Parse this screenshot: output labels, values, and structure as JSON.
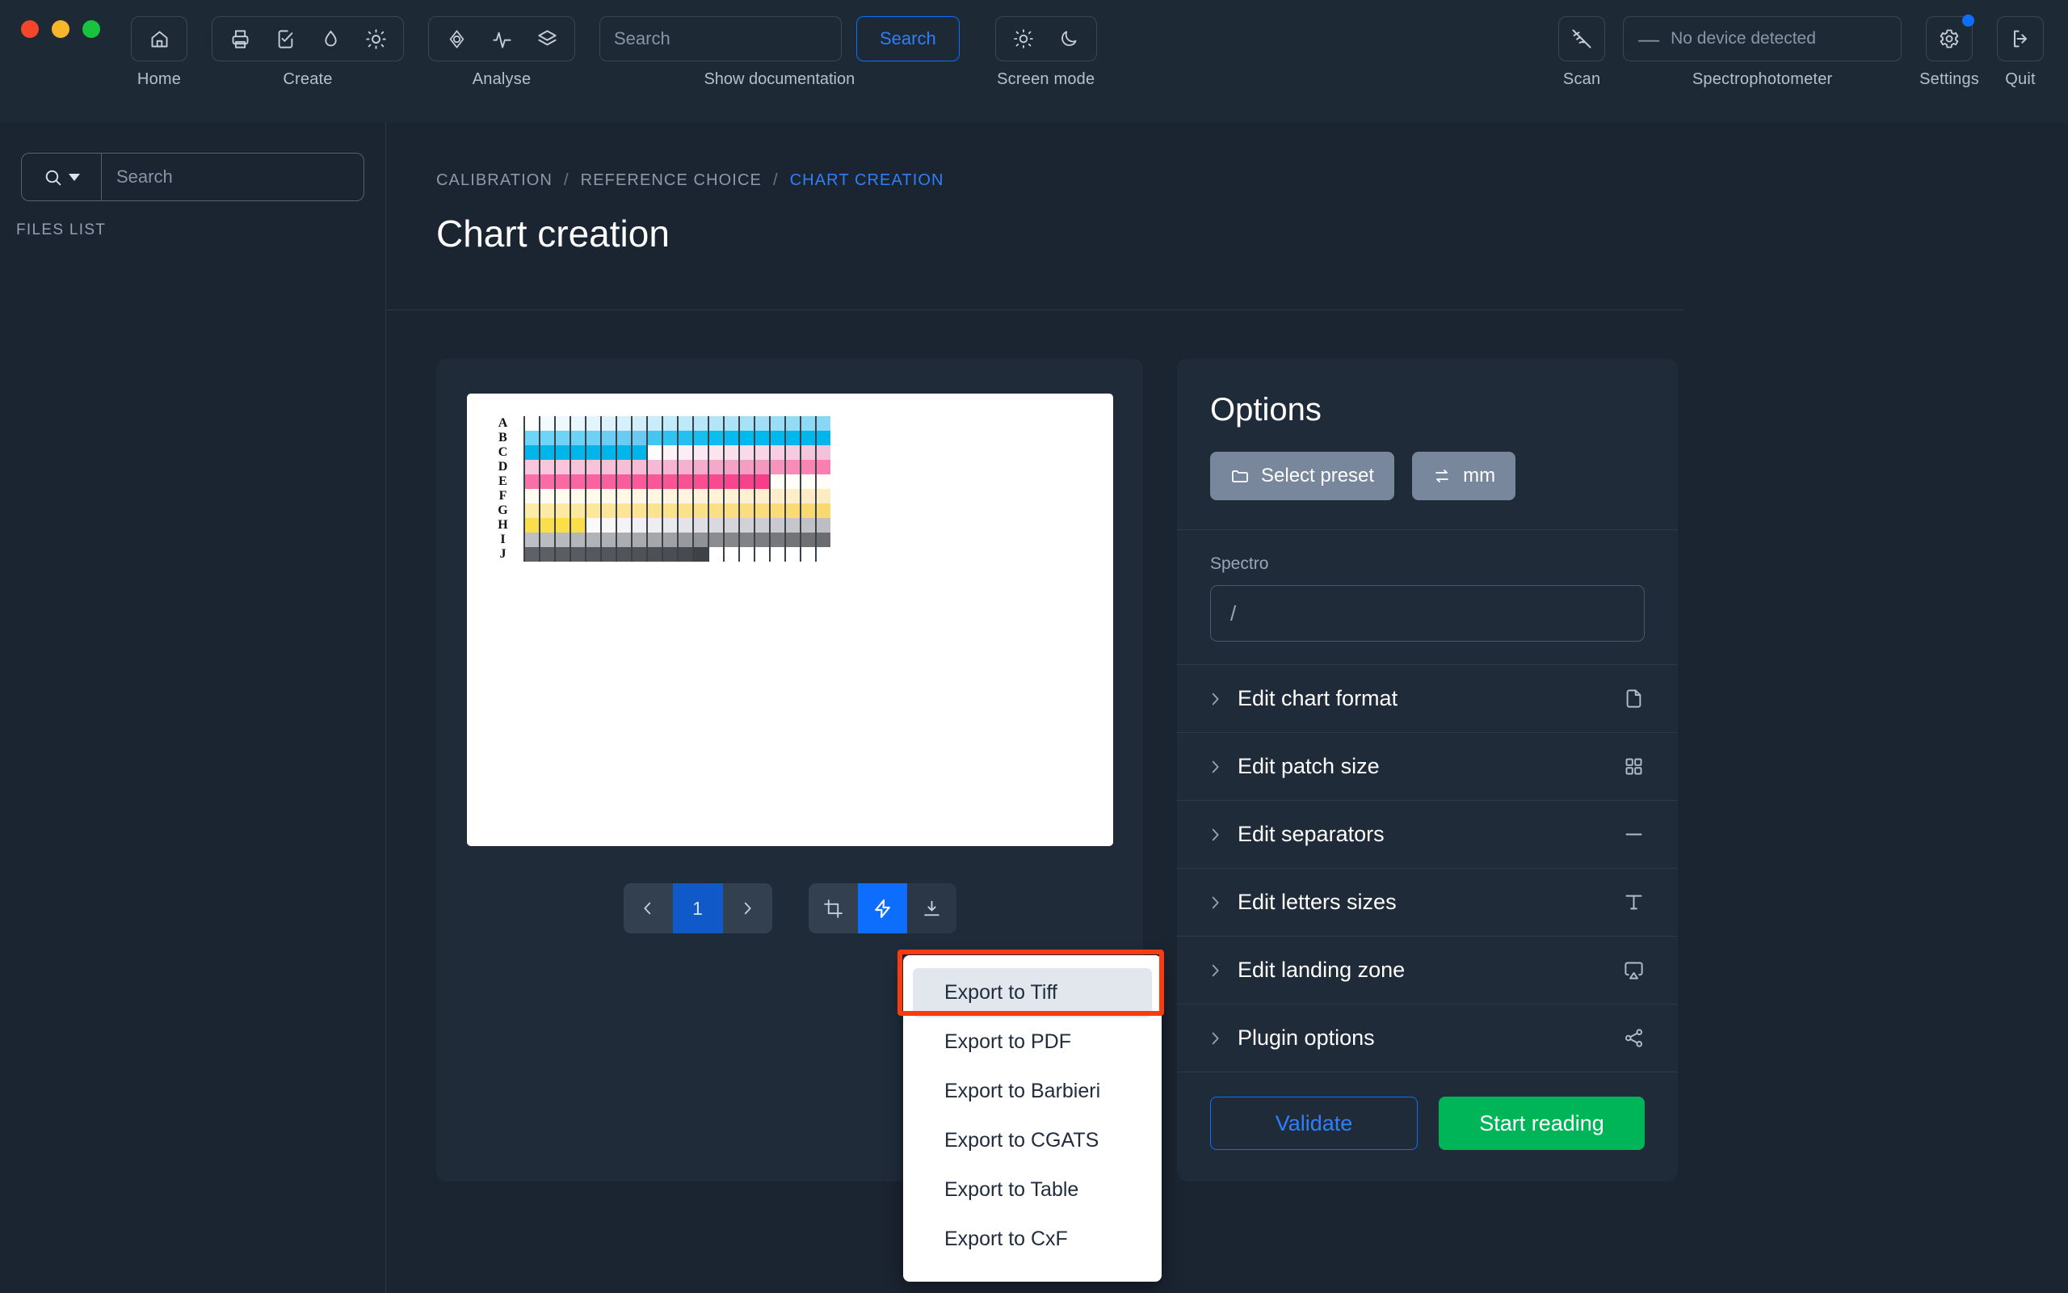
{
  "window": {
    "controls": [
      "close",
      "minimize",
      "maximize"
    ]
  },
  "toolbar": {
    "groups": [
      {
        "label": "Home",
        "items": [
          {
            "icon": "home-icon",
            "name": "home"
          }
        ]
      },
      {
        "label": "Create",
        "items": [
          {
            "icon": "printer-icon",
            "name": "print"
          },
          {
            "icon": "checklist-icon",
            "name": "checklist"
          },
          {
            "icon": "droplet-icon",
            "name": "ink"
          },
          {
            "icon": "sun-icon",
            "name": "light"
          }
        ]
      },
      {
        "label": "Analyse",
        "items": [
          {
            "icon": "gamut-icon",
            "name": "gamut"
          },
          {
            "icon": "pulse-icon",
            "name": "curve"
          },
          {
            "icon": "layers-icon",
            "name": "layers"
          }
        ]
      }
    ],
    "documentation_label": "Show documentation",
    "screen_mode_label": "Screen mode",
    "screen_modes": [
      {
        "icon": "sun-icon",
        "name": "light-mode"
      },
      {
        "icon": "moon-icon",
        "name": "dark-mode"
      }
    ],
    "scan_label": "Scan",
    "scan_icon": "wifi-off-icon",
    "spectrophotometer_label": "Spectrophotometer",
    "device_value": "No device detected",
    "settings_label": "Settings",
    "quit_label": "Quit"
  },
  "search": {
    "placeholder": "Search",
    "button_label": "Search",
    "value": ""
  },
  "sidebar": {
    "search_placeholder": "Search",
    "search_value": "",
    "files_list_label": "FILES LIST",
    "files": []
  },
  "breadcrumb": {
    "items": [
      "CALIBRATION",
      "REFERENCE CHOICE",
      "CHART CREATION"
    ],
    "separator": "/",
    "active_index": 2
  },
  "page": {
    "title": "Chart creation"
  },
  "preview": {
    "pagination": {
      "prev_icon": "chevron-left-icon",
      "page": "1",
      "next_icon": "chevron-right-icon"
    },
    "tools": [
      {
        "icon": "crop-icon",
        "name": "crop",
        "active": false
      },
      {
        "icon": "bolt-icon",
        "name": "auto",
        "active": true
      }
    ],
    "download": {
      "icon": "download-icon",
      "name": "export"
    }
  },
  "export_menu": {
    "items": [
      "Export to Tiff",
      "Export to PDF",
      "Export to Barbieri",
      "Export to CGATS",
      "Export to Table",
      "Export to CxF"
    ],
    "highlighted_index": 0,
    "highlight_color": "#f93b10"
  },
  "options": {
    "title": "Options",
    "preset_button": {
      "label": "Select preset",
      "icon": "folder-icon"
    },
    "unit_button": {
      "label": "mm",
      "icon": "swap-icon"
    },
    "spectro": {
      "label": "Spectro",
      "value": "/"
    },
    "accordions": [
      {
        "label": "Edit chart format",
        "icon": "file-icon"
      },
      {
        "label": "Edit patch size",
        "icon": "grid-icon"
      },
      {
        "label": "Edit separators",
        "icon": "minus-icon"
      },
      {
        "label": "Edit letters sizes",
        "icon": "text-icon"
      },
      {
        "label": "Edit landing zone",
        "icon": "airplay-icon"
      },
      {
        "label": "Plugin options",
        "icon": "share-icon"
      }
    ],
    "validate_label": "Validate",
    "start_reading_label": "Start reading"
  },
  "colors": {
    "accent_blue": "#0d6efd",
    "green": "#00b558",
    "background": "#1b2431",
    "panel": "#202b3a"
  },
  "chart_data": {
    "type": "heatmap",
    "title": "Chart creation patch layout",
    "rows": [
      "A",
      "B",
      "C",
      "D",
      "E",
      "F",
      "G",
      "H",
      "I",
      "J"
    ],
    "columns": 20,
    "description": "Ink ramp test chart: cyan, magenta, yellow and black ramps spread across ten lettered rows with vertical separator bars between patch columns.",
    "row_colors": [
      [
        "#ffffff",
        "#f4fbfe",
        "#eef9fd",
        "#e8f7fd",
        "#e2f5fc",
        "#dcf3fc",
        "#d6f1fb",
        "#d0effb",
        "#caedfa",
        "#c4ebfa",
        "#bee9f9",
        "#b8e7f9",
        "#b2e5f8",
        "#ace3f8",
        "#a6e1f7",
        "#a0dff7",
        "#9addf6",
        "#94dbf6",
        "#8ed9f5",
        "#88d7f5"
      ],
      [
        "#6fd5f6",
        "#6fd5f6",
        "#6ed3f5",
        "#6ed2f5",
        "#6dd0f4",
        "#6ccef3",
        "#6bccf2",
        "#6acaf1",
        "#44c6f0",
        "#30c3ef",
        "#22c1ef",
        "#16bfee",
        "#0dbdee",
        "#06bbed",
        "#00baed",
        "#00b9ec",
        "#00b8ec",
        "#00b7eb",
        "#00b6eb",
        "#00b5ea"
      ],
      [
        "#00b5ea",
        "#00b5ea",
        "#00b5ea",
        "#00b5ea",
        "#00b5ea",
        "#00b5ea",
        "#00b5ea",
        "#00b5ea",
        "#fefcfd",
        "#fdf3f7",
        "#fceef4",
        "#fbe9f1",
        "#fae4ee",
        "#f9dfeb",
        "#f8dae8",
        "#f7d5e5",
        "#f6d0e2",
        "#f5cbdf",
        "#f4c6dc",
        "#f3c1d9"
      ],
      [
        "#fac6dd",
        "#fac6dd",
        "#fac5dc",
        "#f9c3db",
        "#f9c1da",
        "#f8bfd8",
        "#f8bdd7",
        "#f7bbd6",
        "#f7b9d5",
        "#f6b5d2",
        "#f6b1cf",
        "#f5adcc",
        "#f5a8c9",
        "#f4a3c6",
        "#f49ec3",
        "#f399c0",
        "#f794bc",
        "#f98cb6",
        "#fa85b2",
        "#fb7fae"
      ],
      [
        "#fb6fa8",
        "#fb6ca6",
        "#fb69a4",
        "#fb66a2",
        "#fa63a0",
        "#fa609e",
        "#fa5d9c",
        "#fa5a9a",
        "#fa5798",
        "#f95496",
        "#f95194",
        "#f94e92",
        "#f84a90",
        "#f8468e",
        "#f8428b",
        "#f83e89",
        "#fffef7",
        "#fffef7",
        "#fffef6",
        "#fffdf5"
      ],
      [
        "#fffdf0",
        "#fffdef",
        "#fffced",
        "#fffbeb",
        "#fffae9",
        "#fff9e7",
        "#fff8e5",
        "#fff7e3",
        "#fff6e1",
        "#fff5df",
        "#fff4dd",
        "#fef3da",
        "#fef2d7",
        "#fef1d4",
        "#fef0d1",
        "#feefce",
        "#fdeecb",
        "#fdedc8",
        "#fdecc5",
        "#fdebc2"
      ],
      [
        "#fdeba8",
        "#fdeaa5",
        "#fde9a2",
        "#fde89f",
        "#fce79c",
        "#fce699",
        "#fce596",
        "#fce493",
        "#fce390",
        "#fbe28d",
        "#fbe18a",
        "#fbe087",
        "#fbdf84",
        "#fade81",
        "#fadd7e",
        "#fadc7b",
        "#fadb78",
        "#f9da75",
        "#f9d972",
        "#f9d86f"
      ],
      [
        "#fbdf4a",
        "#fbdf4a",
        "#fbde48",
        "#fbde48",
        "#fafafb",
        "#f8f8f9",
        "#f4f4f6",
        "#f1f1f3",
        "#eeeef0",
        "#eaeaed",
        "#e4e4e8",
        "#dedee3",
        "#d9d9de",
        "#d5d5da",
        "#d1d1d6",
        "#cdcdd2",
        "#c9c9ce",
        "#c5c5ca",
        "#c1c1c6",
        "#bdbdc2"
      ],
      [
        "#bdbfc2",
        "#babcbf",
        "#b7b9bc",
        "#b4b6b9",
        "#b1b3b6",
        "#aeb0b3",
        "#abadb0",
        "#a8aaad",
        "#a5a7aa",
        "#9fa1a4",
        "#97999c",
        "#909295",
        "#8a8c8f",
        "#858789",
        "#808285",
        "#7b7d80",
        "#76787b",
        "#727477",
        "#6e7073",
        "#6a6c6f"
      ],
      [
        "#5e6267",
        "#5c6065",
        "#5a5e63",
        "#585c61",
        "#55595e",
        "#53575c",
        "#51555a",
        "#4f5358",
        "#4d5156",
        "#4a4e53",
        "#474b50",
        "#3e4247",
        "#ffffff",
        "#ffffff",
        "#ffffff",
        "#ffffff",
        "#ffffff",
        "#ffffff",
        "#ffffff",
        "#ffffff"
      ]
    ]
  }
}
